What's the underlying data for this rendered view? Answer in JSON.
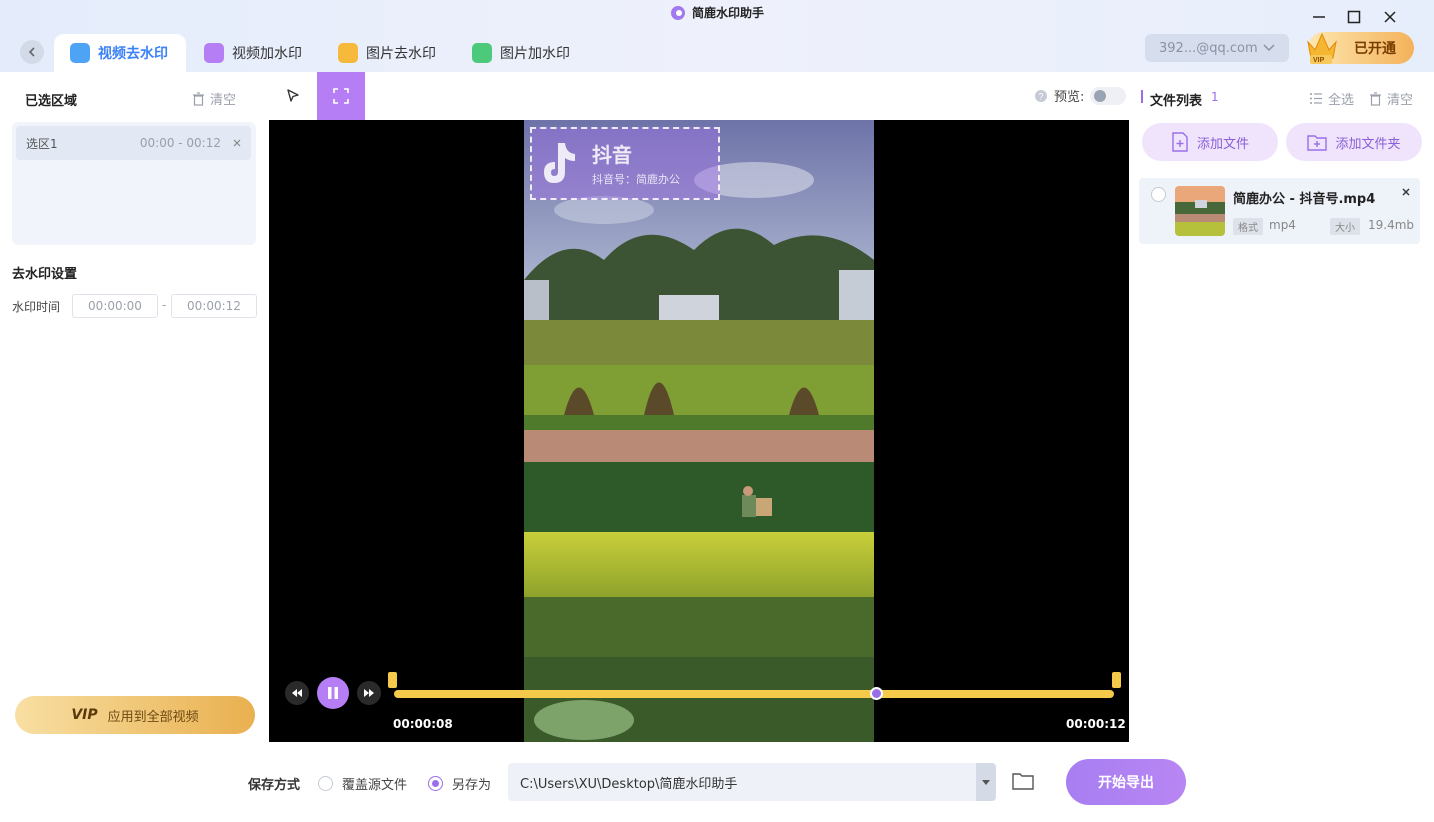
{
  "app": {
    "title": "简鹿水印助手",
    "account": "392...@qq.com",
    "vip_label": "已开通"
  },
  "tabs": [
    {
      "label": "视频去水印",
      "active": true
    },
    {
      "label": "视频加水印"
    },
    {
      "label": "图片去水印"
    },
    {
      "label": "图片加水印"
    }
  ],
  "left": {
    "selected_title": "已选区域",
    "clear_label": "清空",
    "regions": [
      {
        "name": "选区1",
        "range": "00:00 - 00:12"
      }
    ],
    "settings_title": "去水印设置",
    "time_label": "水印时间",
    "time_start": "00:00:00",
    "time_end": "00:00:12",
    "dash": "-",
    "apply_vip": "VIP",
    "apply_label": "应用到全部视频"
  },
  "player": {
    "watermark_brand": "抖音",
    "watermark_sub": "抖音号：简鹿办公",
    "current_time": "00:00:08",
    "end_time": "00:00:12",
    "progress": 0.67
  },
  "right": {
    "preview_label": "预览:",
    "list_title": "文件列表",
    "list_count": "1",
    "select_all": "全选",
    "clear_label": "清空",
    "add_file": "添加文件",
    "add_folder": "添加文件夹",
    "files": [
      {
        "name": "简鹿办公 - 抖音号.mp4",
        "format_tag": "格式",
        "format": "mp4",
        "size_tag": "大小",
        "size": "19.4mb"
      }
    ]
  },
  "bottom": {
    "save_mode_label": "保存方式",
    "opt_overwrite": "覆盖源文件",
    "opt_saveas": "另存为",
    "path": "C:\\Users\\XU\\Desktop\\简鹿水印助手",
    "export_label": "开始导出"
  },
  "colors": {
    "accent": "#b57ef5",
    "tab_active": "#3b82f6",
    "timeline": "#f5c94a"
  }
}
